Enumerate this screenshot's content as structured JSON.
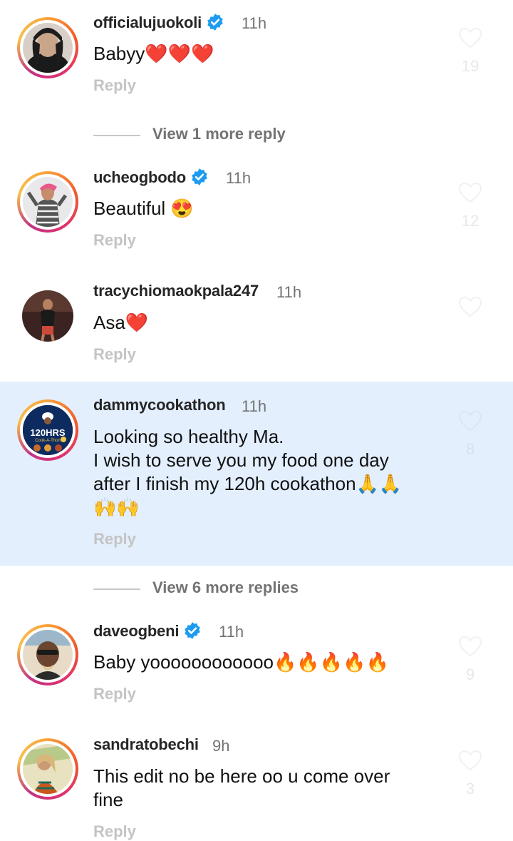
{
  "comments": [
    {
      "username": "officialujuokoli",
      "verified": true,
      "time": "11h",
      "text": "Babyy❤️❤️❤️",
      "reply_label": "Reply",
      "likes": "19"
    },
    {
      "username": "ucheogbodo",
      "verified": true,
      "time": "11h",
      "text": "Beautiful 😍",
      "reply_label": "Reply",
      "likes": "12"
    },
    {
      "username": "tracychiomaokpala247",
      "verified": false,
      "time": "11h",
      "text": "Asa❤️",
      "reply_label": "Reply",
      "likes": ""
    },
    {
      "username": "dammycookathon",
      "verified": false,
      "time": "11h",
      "text_lines": [
        "Looking so healthy Ma.",
        "I wish to serve you my food one day",
        "after I finish my 120h cookathon🙏🙏",
        "🙌🙌"
      ],
      "reply_label": "Reply",
      "likes": "8",
      "avatar_text": "120HRS",
      "avatar_subtext": "Cook-A-Thon"
    },
    {
      "username": "daveogbeni",
      "verified": true,
      "time": "11h",
      "text": "Baby yoooooooooooo🔥🔥🔥🔥🔥",
      "reply_label": "Reply",
      "likes": "9"
    },
    {
      "username": "sandratobechi",
      "verified": false,
      "time": "9h",
      "text_lines": [
        "This edit no be here oo u come over",
        "fine"
      ],
      "reply_label": "Reply",
      "likes": "3"
    }
  ],
  "view_more_1": "View 1 more reply",
  "view_more_2": "View 6 more replies",
  "colors": {
    "highlight": "#e3effd",
    "verified": "#1d9bf0",
    "muted": "#737373"
  }
}
